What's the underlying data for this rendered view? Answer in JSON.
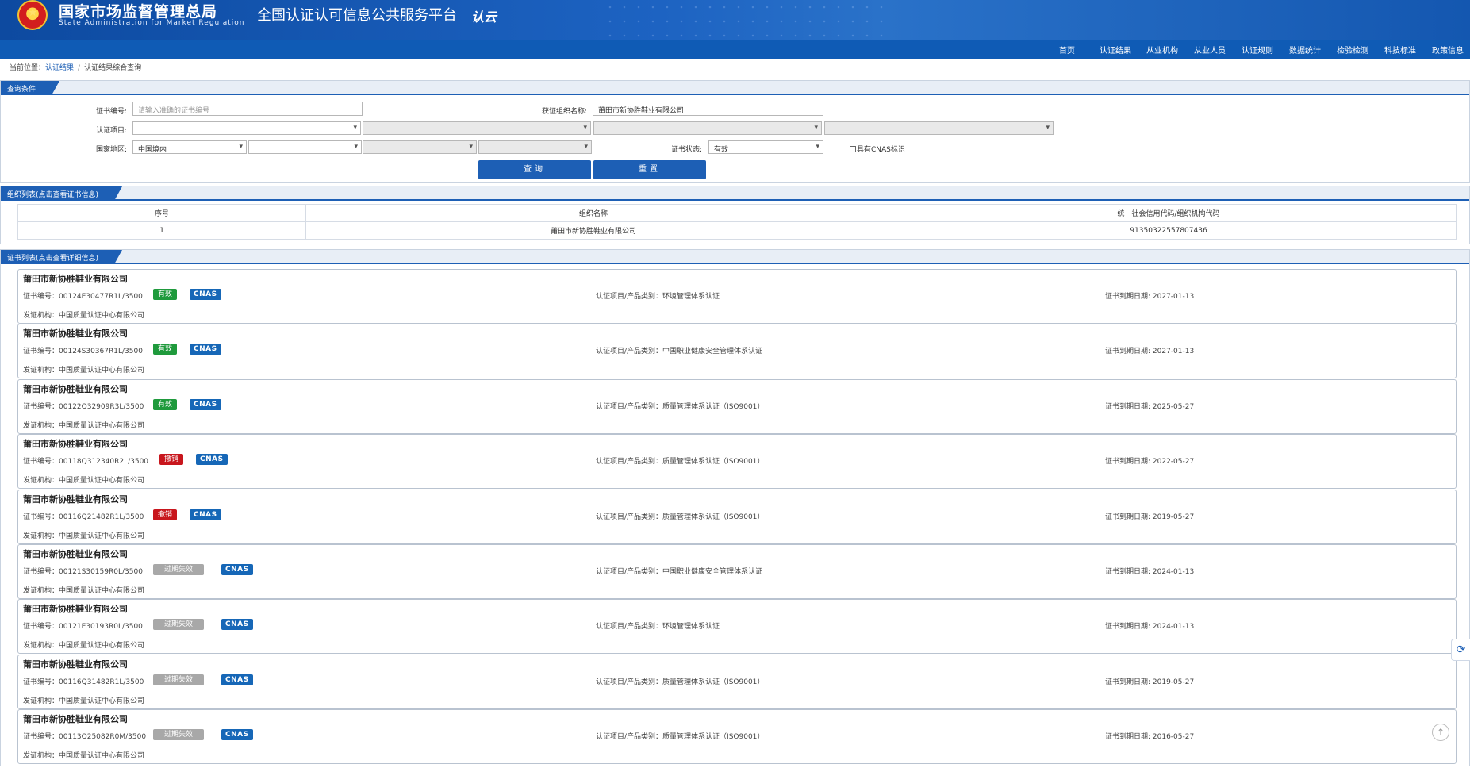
{
  "header": {
    "org_cn": "国家市场监督管理总局",
    "org_en": "State Administration for Market Regulation",
    "platform": "全国认证认可信息公共服务平台",
    "logo_text": "认云"
  },
  "nav": [
    "首页",
    "认证结果",
    "从业机构",
    "从业人员",
    "认证规则",
    "数据统计",
    "检验检测",
    "科技标准",
    "政策信息"
  ],
  "breadcrumb": {
    "prefix": "当前位置：",
    "link": "认证结果",
    "current": "认证结果综合查询"
  },
  "query": {
    "title": "查询条件",
    "cert_no_label": "证书编号:",
    "cert_no_placeholder": "请输入准确的证书编号",
    "org_name_label": "获证组织名称:",
    "org_name_value": "莆田市新协胜鞋业有限公司",
    "project_label": "认证项目:",
    "region_label": "国家地区:",
    "region_value": "中国境内",
    "status_label": "证书状态:",
    "status_value": "有效",
    "cnas_label": "具有CNAS标识",
    "query_btn": "查询",
    "reset_btn": "重置"
  },
  "org_list": {
    "title": "组织列表(点击查看证书信息)",
    "columns": [
      "序号",
      "组织名称",
      "统一社会信用代码/组织机构代码"
    ],
    "rows": [
      [
        "1",
        "莆田市新协胜鞋业有限公司",
        "91350322557807436"
      ]
    ]
  },
  "cert_list": {
    "title": "证书列表(点击查看详细信息)",
    "cnas": "CNAS",
    "no_label": "证书编号：",
    "issuer_label": "发证机构：",
    "proj_label": "认证项目/产品类别：",
    "exp_label": "证书到期日期: ",
    "items": [
      {
        "name": "莆田市新协胜鞋业有限公司",
        "no": "00124E30477R1L/3500",
        "status": "有效",
        "project": "环境管理体系认证",
        "expiry": "2027-01-13",
        "issuer": "中国质量认证中心有限公司"
      },
      {
        "name": "莆田市新协胜鞋业有限公司",
        "no": "00124S30367R1L/3500",
        "status": "有效",
        "project": "中国职业健康安全管理体系认证",
        "expiry": "2027-01-13",
        "issuer": "中国质量认证中心有限公司"
      },
      {
        "name": "莆田市新协胜鞋业有限公司",
        "no": "00122Q32909R3L/3500",
        "status": "有效",
        "project": "质量管理体系认证（ISO9001）",
        "expiry": "2025-05-27",
        "issuer": "中国质量认证中心有限公司"
      },
      {
        "name": "莆田市新协胜鞋业有限公司",
        "no": "00118Q312340R2L/3500",
        "status": "撤销",
        "project": "质量管理体系认证（ISO9001）",
        "expiry": "2022-05-27",
        "issuer": "中国质量认证中心有限公司"
      },
      {
        "name": "莆田市新协胜鞋业有限公司",
        "no": "00116Q21482R1L/3500",
        "status": "撤销",
        "project": "质量管理体系认证（ISO9001）",
        "expiry": "2019-05-27",
        "issuer": "中国质量认证中心有限公司"
      },
      {
        "name": "莆田市新协胜鞋业有限公司",
        "no": "00121S30159R0L/3500",
        "status": "过期失效",
        "project": "中国职业健康安全管理体系认证",
        "expiry": "2024-01-13",
        "issuer": "中国质量认证中心有限公司"
      },
      {
        "name": "莆田市新协胜鞋业有限公司",
        "no": "00121E30193R0L/3500",
        "status": "过期失效",
        "project": "环境管理体系认证",
        "expiry": "2024-01-13",
        "issuer": "中国质量认证中心有限公司"
      },
      {
        "name": "莆田市新协胜鞋业有限公司",
        "no": "00116Q31482R1L/3500",
        "status": "过期失效",
        "project": "质量管理体系认证（ISO9001）",
        "expiry": "2019-05-27",
        "issuer": "中国质量认证中心有限公司"
      },
      {
        "name": "莆田市新协胜鞋业有限公司",
        "no": "00113Q25082R0M/3500",
        "status": "过期失效",
        "project": "质量管理体系认证（ISO9001）",
        "expiry": "2016-05-27",
        "issuer": "中国质量认证中心有限公司"
      }
    ]
  },
  "colors": {
    "nav": "#0f5bb5",
    "valid": "#1f9a3c",
    "revoked": "#c8161d",
    "expired": "#a8a8a8",
    "cnas": "#1667b7"
  }
}
